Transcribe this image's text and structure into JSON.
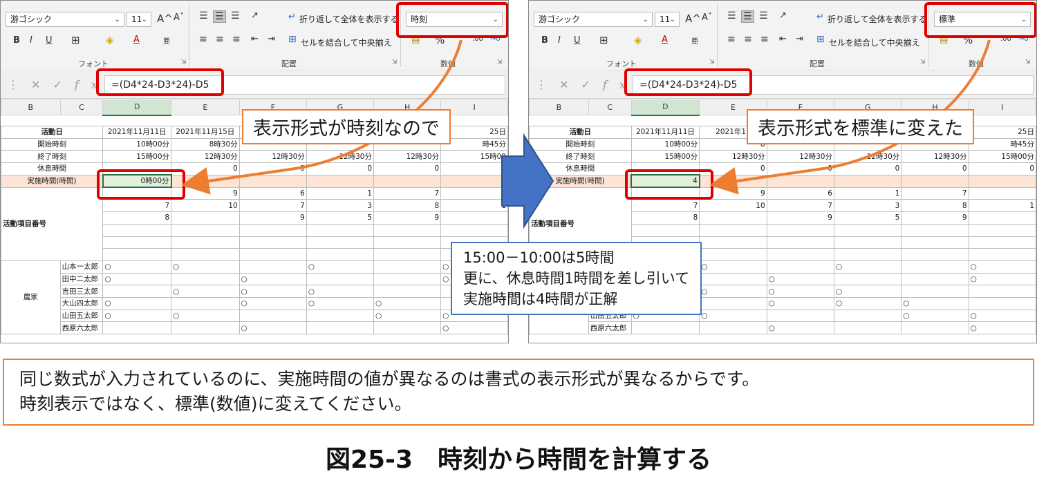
{
  "colors": {
    "highlight": "#e00000",
    "callout_border": "#ed7d31",
    "note_border": "#4472c4",
    "arrow_blue": "#4472c4",
    "arrow_orange": "#ed7d31",
    "calc_row_bg": "#fce4d6"
  },
  "ribbon": {
    "font_name": "游ゴシック",
    "font_size": "11",
    "grow_font": "A^",
    "shrink_font": "Aˇ",
    "bold": "B",
    "italic": "I",
    "underline": "U",
    "font_color": "A",
    "wrap_text": "折り返して全体を表示する",
    "merge_center": "セルを結合して中央揃え",
    "group_font": "フォント",
    "group_alignment": "配置",
    "group_number": "数値",
    "percent": "%"
  },
  "left": {
    "number_format": "時刻",
    "formula": "=(D4*24-D3*24)-D5",
    "calc_value": "0時00分",
    "callout": "表示形式が時刻なので",
    "start_times": [
      "10時00分",
      "8時30分",
      "",
      "",
      "",
      "時45分"
    ],
    "end_times": [
      "15時00分",
      "12時30分",
      "12時30分",
      "12時30分",
      "12時30分",
      "15時00"
    ],
    "header_e": "2021年11月15日",
    "header_last": "25日"
  },
  "right": {
    "number_format": "標準",
    "formula": "=(D4*24-D3*24)-D5",
    "calc_value": "4",
    "callout": "表示形式を標準に変えた",
    "start_times": [
      "10時00分",
      "8",
      "",
      "",
      "",
      "時45分"
    ],
    "end_times": [
      "15時00分",
      "12時30分",
      "12時30分",
      "12時30分",
      "12時30分",
      "15時00分"
    ],
    "header_e": "2021年11",
    "header_last": "25日"
  },
  "sheet": {
    "columns": [
      "B",
      "C",
      "D",
      "E",
      "F",
      "G",
      "H",
      "I"
    ],
    "row_labels": {
      "activity_date": "活動日",
      "start": "開始時刻",
      "end": "終了時刻",
      "break": "休息時間",
      "actual": "実施時間(時間)",
      "activity_no": "活動項目番号",
      "farmer": "農家"
    },
    "header_d": "2021年11月11日",
    "break_values": [
      "",
      "0",
      "0",
      "0",
      "0",
      "0"
    ],
    "activity_rows": [
      [
        "",
        "9",
        "6",
        "1",
        "7",
        ""
      ],
      [
        "7",
        "10",
        "7",
        "3",
        "8",
        "1"
      ],
      [
        "8",
        "",
        "9",
        "5",
        "9",
        ""
      ]
    ],
    "circle": "○",
    "people": [
      {
        "name": "山本一太郎",
        "marks": [
          true,
          true,
          false,
          true,
          false,
          true
        ]
      },
      {
        "name": "田中二太郎",
        "marks": [
          true,
          false,
          true,
          false,
          false,
          true
        ]
      },
      {
        "name": "吉田三太郎",
        "marks": [
          false,
          true,
          true,
          true,
          false,
          false
        ]
      },
      {
        "name": "大山四太郎",
        "marks": [
          true,
          false,
          true,
          true,
          true,
          false
        ]
      },
      {
        "name": "山田五太郎",
        "marks": [
          true,
          true,
          false,
          false,
          true,
          true
        ]
      },
      {
        "name": "西原六太郎",
        "marks": [
          false,
          false,
          true,
          false,
          false,
          true
        ]
      }
    ]
  },
  "note": {
    "lines": [
      "15:00－10:00は5時間",
      "更に、休息時間1時間を差し引いて",
      "実施時間は4時間が正解"
    ]
  },
  "caption": {
    "lines": [
      "同じ数式が入力されているのに、実施時間の値が異なるのは書式の表示形式が異なるからです。",
      "時刻表示ではなく、標準(数値)に変えてください。"
    ]
  },
  "figure_title": "図25-3　時刻から時間を計算する"
}
